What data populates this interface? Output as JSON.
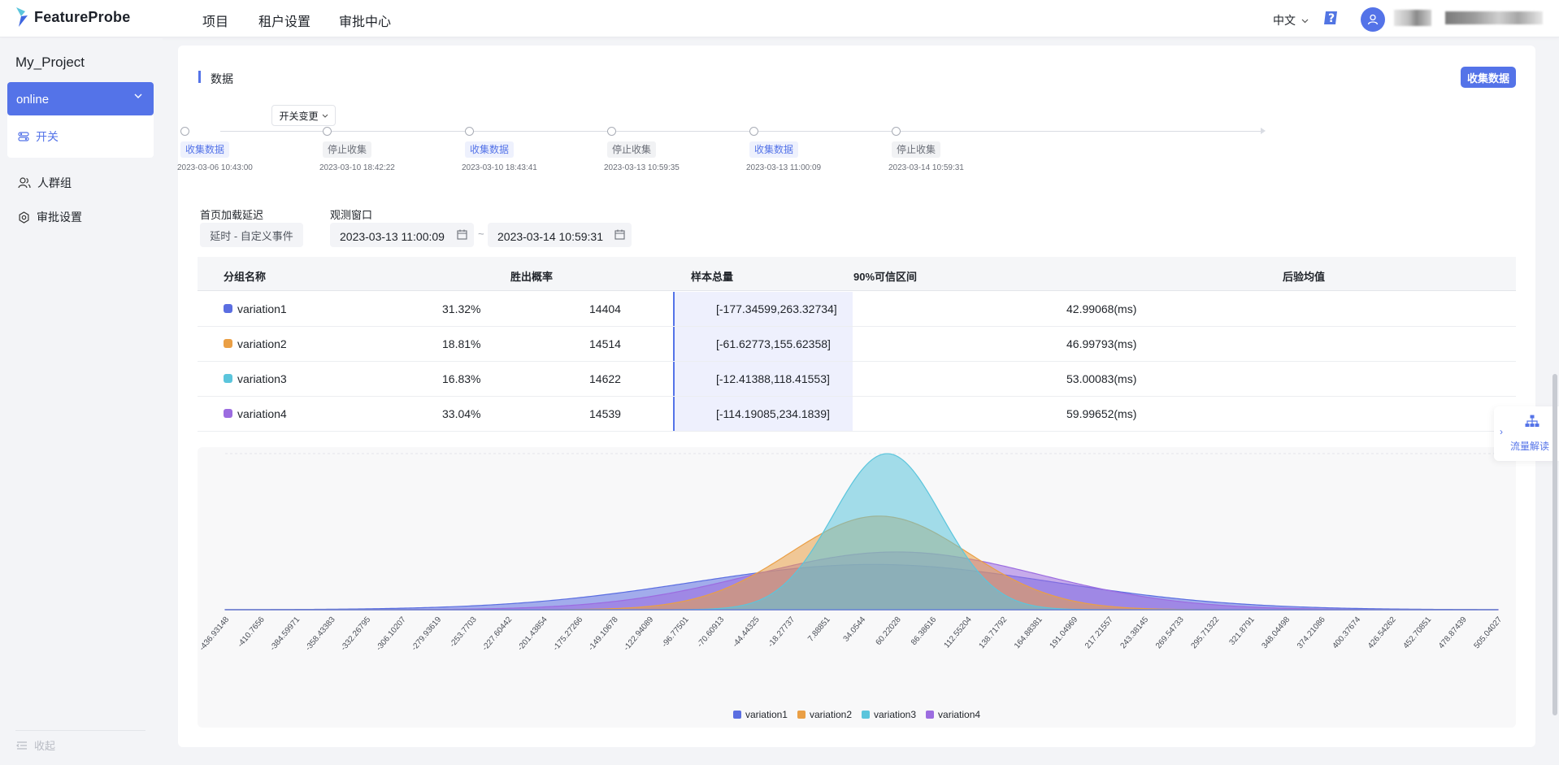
{
  "app": {
    "logo_text": "FeatureProbe"
  },
  "topnav": {
    "items": [
      "项目",
      "租户设置",
      "审批中心"
    ],
    "language": "中文"
  },
  "sidebar": {
    "project_name": "My_Project",
    "environment": "online",
    "menu": {
      "toggles": "开关",
      "segments": "人群组",
      "approval_settings": "审批设置"
    },
    "collapse": "收起"
  },
  "data_section": {
    "title": "数据",
    "collect_button": "收集数据",
    "change_filter": "开关变更",
    "timeline": [
      {
        "label": "收集数据",
        "state": "on",
        "time": "2023-03-06 10:43:00"
      },
      {
        "label": "停止收集",
        "state": "off",
        "time": "2023-03-10 18:42:22"
      },
      {
        "label": "收集数据",
        "state": "on",
        "time": "2023-03-10 18:43:41"
      },
      {
        "label": "停止收集",
        "state": "off",
        "time": "2023-03-13 10:59:35"
      },
      {
        "label": "收集数据",
        "state": "on",
        "time": "2023-03-13 11:00:09"
      },
      {
        "label": "停止收集",
        "state": "off",
        "time": "2023-03-14 10:59:31"
      }
    ],
    "metric_label": "首页加载延迟",
    "metric_value": "延时 - 自定义事件",
    "window_label": "观测窗口",
    "window_start": "2023-03-13 11:00:09",
    "window_end": "2023-03-14 10:59:31",
    "window_sep": "~"
  },
  "table": {
    "headers": [
      "分组名称",
      "胜出概率",
      "样本总量",
      "90%可信区间",
      "后验均值"
    ],
    "rows": [
      {
        "name": "variation1",
        "win": "31.32%",
        "samples": "14404",
        "ci": "[-177.34599,263.32734]",
        "mean": "42.99068(ms)",
        "color": "#5b6ee1"
      },
      {
        "name": "variation2",
        "win": "18.81%",
        "samples": "14514",
        "ci": "[-61.62773,155.62358]",
        "mean": "46.99793(ms)",
        "color": "#ea9f45"
      },
      {
        "name": "variation3",
        "win": "16.83%",
        "samples": "14622",
        "ci": "[-12.41388,118.41553]",
        "mean": "53.00083(ms)",
        "color": "#5bc5dc"
      },
      {
        "name": "variation4",
        "win": "33.04%",
        "samples": "14539",
        "ci": "[-114.19085,234.1839]",
        "mean": "59.99652(ms)",
        "color": "#9c6ce0"
      }
    ]
  },
  "chart_data": {
    "type": "area",
    "x_tick_labels": [
      "-436.93148",
      "-410.7656",
      "-384.59971",
      "-358.43383",
      "-332.26795",
      "-306.10207",
      "-279.93619",
      "-253.7703",
      "-227.60442",
      "-201.43854",
      "-175.27266",
      "-149.10678",
      "-122.94089",
      "-96.77501",
      "-70.60913",
      "-44.44325",
      "-18.27737",
      "7.88851",
      "34.0544",
      "60.22028",
      "86.38616",
      "112.55204",
      "138.71792",
      "164.88381",
      "191.04969",
      "217.21557",
      "243.38145",
      "269.54733",
      "295.71322",
      "321.8791",
      "348.04498",
      "374.21086",
      "400.37674",
      "426.54262",
      "452.70851",
      "478.87439",
      "505.04027"
    ],
    "x_range": [
      -436.93148,
      505.04027
    ],
    "series": [
      {
        "name": "variation1",
        "color": "#5b6ee1",
        "mean": 42.99068,
        "sd": 134.0,
        "peak_relative": 0.29
      },
      {
        "name": "variation2",
        "color": "#ea9f45",
        "mean": 46.99793,
        "sd": 66.0,
        "peak_relative": 0.6
      },
      {
        "name": "variation3",
        "color": "#5bc5dc",
        "mean": 53.00083,
        "sd": 40.0,
        "peak_relative": 1.0
      },
      {
        "name": "variation4",
        "color": "#9c6ce0",
        "mean": 59.99652,
        "sd": 106.0,
        "peak_relative": 0.37
      }
    ],
    "legend_position": "bottom"
  },
  "float_widget": {
    "label": "流量解读"
  }
}
